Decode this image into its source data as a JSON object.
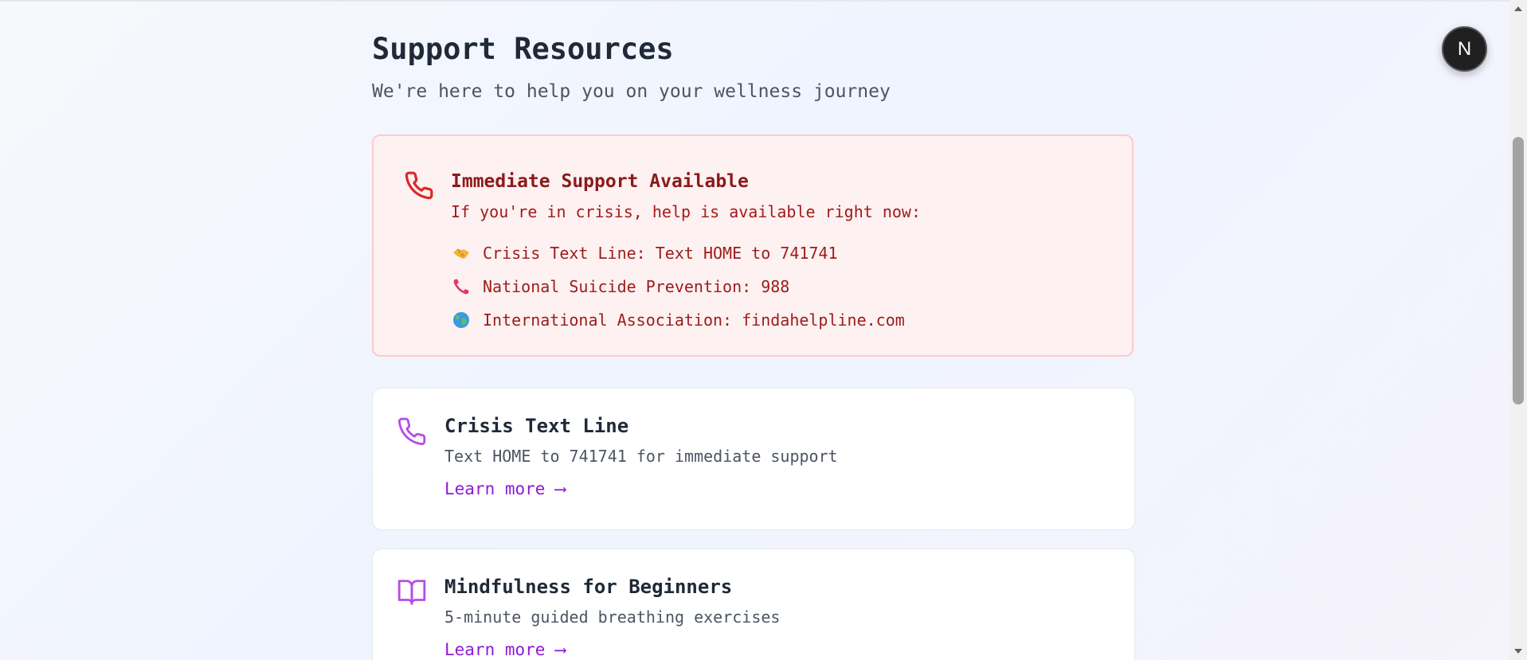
{
  "header": {
    "title": "Support Resources",
    "subtitle": "We're here to help you on your wellness journey"
  },
  "crisis": {
    "icon": "phone-icon",
    "title": "Immediate Support Available",
    "intro": "If you're in crisis, help is available right now:",
    "items": [
      {
        "emoji": "handshake-icon",
        "text": "Crisis Text Line: Text HOME to 741741"
      },
      {
        "emoji": "telephone-receiver-icon",
        "text": "National Suicide Prevention: 988"
      },
      {
        "emoji": "globe-icon",
        "text": "International Association: findahelpline.com"
      }
    ]
  },
  "resources": [
    {
      "icon": "phone-icon",
      "title": "Crisis Text Line",
      "description": "Text HOME to 741741 for immediate support",
      "link": "Learn more ⟶"
    },
    {
      "icon": "book-open-icon",
      "title": "Mindfulness for Beginners",
      "description": "5-minute guided breathing exercises",
      "link": "Learn more ⟶"
    }
  ],
  "avatar": {
    "letter": "N"
  },
  "colors": {
    "crisis_bg": "#fef1f1",
    "crisis_border": "#fecaca",
    "crisis_text": "#9b1c1c",
    "accent": "#8e1ad6",
    "icon_purple": "#b54de8",
    "icon_red": "#dc2626"
  }
}
